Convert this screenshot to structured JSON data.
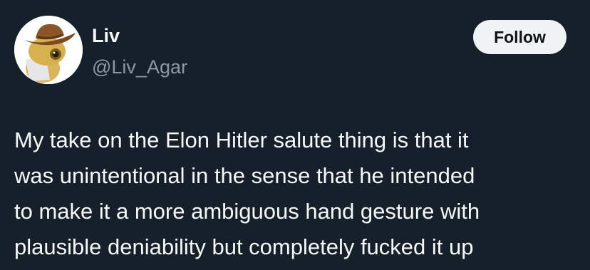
{
  "author": {
    "display_name": "Liv",
    "handle": "@Liv_Agar",
    "avatar_icon": "cowboy-hat-frog-avatar"
  },
  "actions": {
    "follow_label": "Follow"
  },
  "tweet": {
    "lines": [
      "My take on the Elon Hitler salute thing is that it",
      "was unintentional in the sense that he intended",
      "to make it a more ambiguous hand gesture with",
      "plausible deniability but completely fucked it up"
    ]
  },
  "colors": {
    "background": "#15202b",
    "text": "#f7f9f9",
    "secondary_text": "#8b98a5",
    "button_bg": "#eff3f4",
    "button_text": "#0f1419"
  }
}
